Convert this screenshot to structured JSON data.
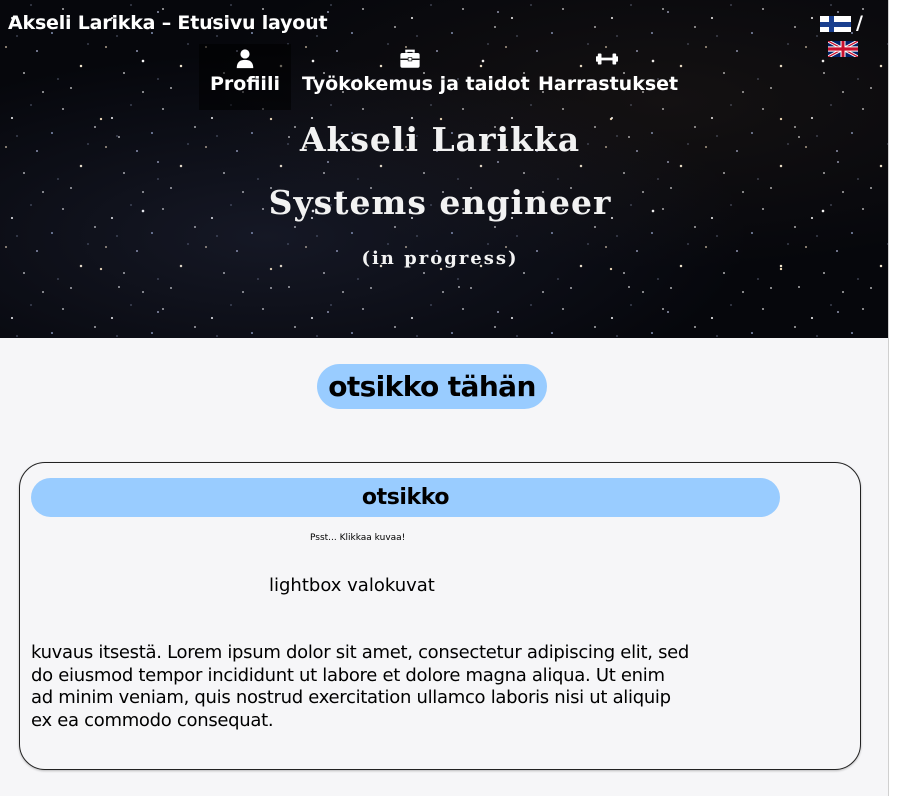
{
  "header": {
    "site_title": "Akseli Larikka – Etusivu layout",
    "lang_separator": "/",
    "flags": [
      "finnish-flag-icon",
      "uk-flag-icon"
    ]
  },
  "nav": {
    "items": [
      {
        "label": "Profiili",
        "icon": "user-icon",
        "active": true
      },
      {
        "label": "Työkokemus ja taidot",
        "icon": "briefcase-icon",
        "active": false
      },
      {
        "label": "Harrastukset",
        "icon": "dumbbell-icon",
        "active": false
      }
    ]
  },
  "hero": {
    "name": "Akseli Larikka",
    "role": "Systems engineer",
    "status": "(in progress)"
  },
  "main": {
    "section_heading": "otsikko tähän",
    "card": {
      "title": "otsikko",
      "hint": "Psst... Klikkaa kuvaa!",
      "lightbox_text": "lightbox valokuvat",
      "about_text": "kuvaus itsestä. Lorem ipsum dolor sit amet, consectetur adipiscing elit, sed do eiusmod tempor incididunt ut labore et dolore magna aliqua. Ut enim ad minim veniam, quis nostrud exercitation ullamco laboris nisi ut aliquip ex ea commodo consequat."
    }
  },
  "colors": {
    "accent_blue": "#99ccff",
    "page_background": "#f6f6f8",
    "hero_background": "#06070c",
    "text_light": "#ffffff"
  }
}
